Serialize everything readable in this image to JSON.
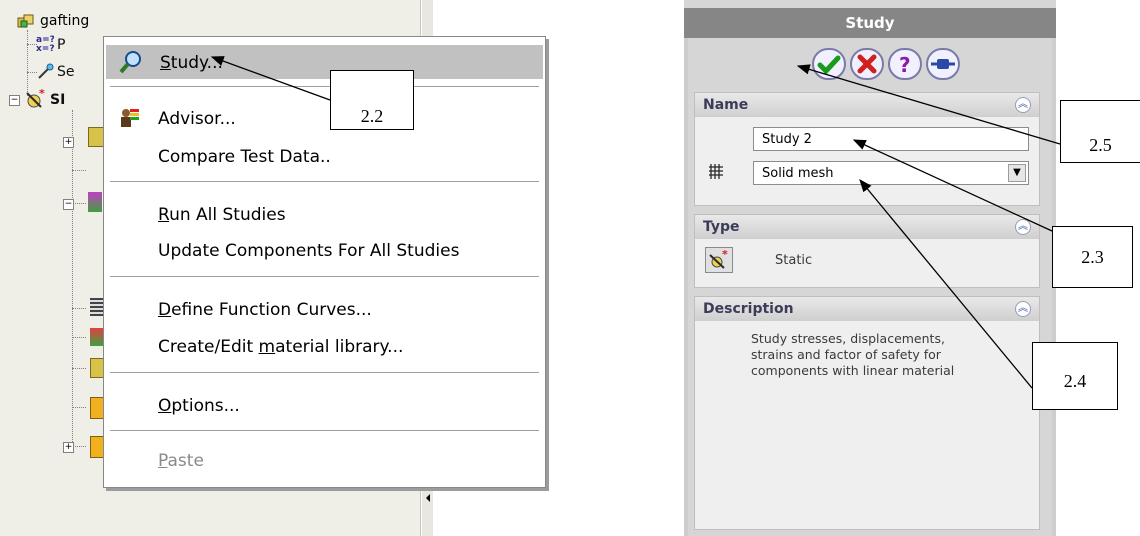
{
  "tree": {
    "root_label": "gafting",
    "fragments": [
      "P",
      "Se",
      "SI"
    ]
  },
  "menu": {
    "items": [
      {
        "label": "Study...",
        "underline": "S",
        "icon": "magnifier-icon",
        "highlighted": true
      },
      {
        "label": "Advisor...",
        "icon": "advisor-icon"
      },
      {
        "label": "Compare Test Data.."
      },
      {
        "label": "Run All Studies",
        "underline": "R"
      },
      {
        "label": "Update Components For All  Studies"
      },
      {
        "label": "Define Function Curves...",
        "underline": "D"
      },
      {
        "label": "Create/Edit material library...",
        "underline": "m"
      },
      {
        "label": "Options...",
        "underline": "O"
      },
      {
        "label": "Paste",
        "underline": "P",
        "disabled": true
      }
    ]
  },
  "study": {
    "title": "Study",
    "buttons": [
      "ok-check-icon",
      "cancel-x-icon",
      "help-question-icon",
      "pin-icon"
    ],
    "name_group": {
      "header": "Name",
      "name_value": "Study 2",
      "mesh_value": "Solid mesh"
    },
    "type_group": {
      "header": "Type",
      "type_value": "Static"
    },
    "description_group": {
      "header": "Description",
      "text": "Study stresses, displacements,\nstrains and factor of safety  for\ncomponents with linear material"
    }
  },
  "callouts": [
    "2.2",
    "2.5",
    "2.3",
    "2.4"
  ],
  "colors": {
    "menu_highlight": "#c1c1c1",
    "panel_title": "#868686",
    "group_header_text": "#3c3c5a"
  }
}
